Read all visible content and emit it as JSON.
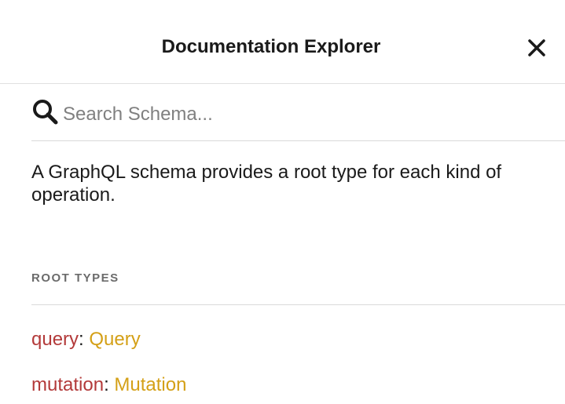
{
  "header": {
    "title": "Documentation Explorer",
    "close_icon": "close-icon"
  },
  "search": {
    "icon": "search-icon",
    "placeholder": "Search Schema..."
  },
  "description": "A GraphQL schema provides a root type for each kind of operation.",
  "root_types": {
    "section_title": "ROOT TYPES",
    "items": [
      {
        "field": "query",
        "separator": ": ",
        "type": "Query"
      },
      {
        "field": "mutation",
        "separator": ": ",
        "type": "Mutation"
      }
    ]
  },
  "colors": {
    "field": "#b33a3a",
    "type": "#d4a017",
    "section_title": "#6b6b6b"
  }
}
